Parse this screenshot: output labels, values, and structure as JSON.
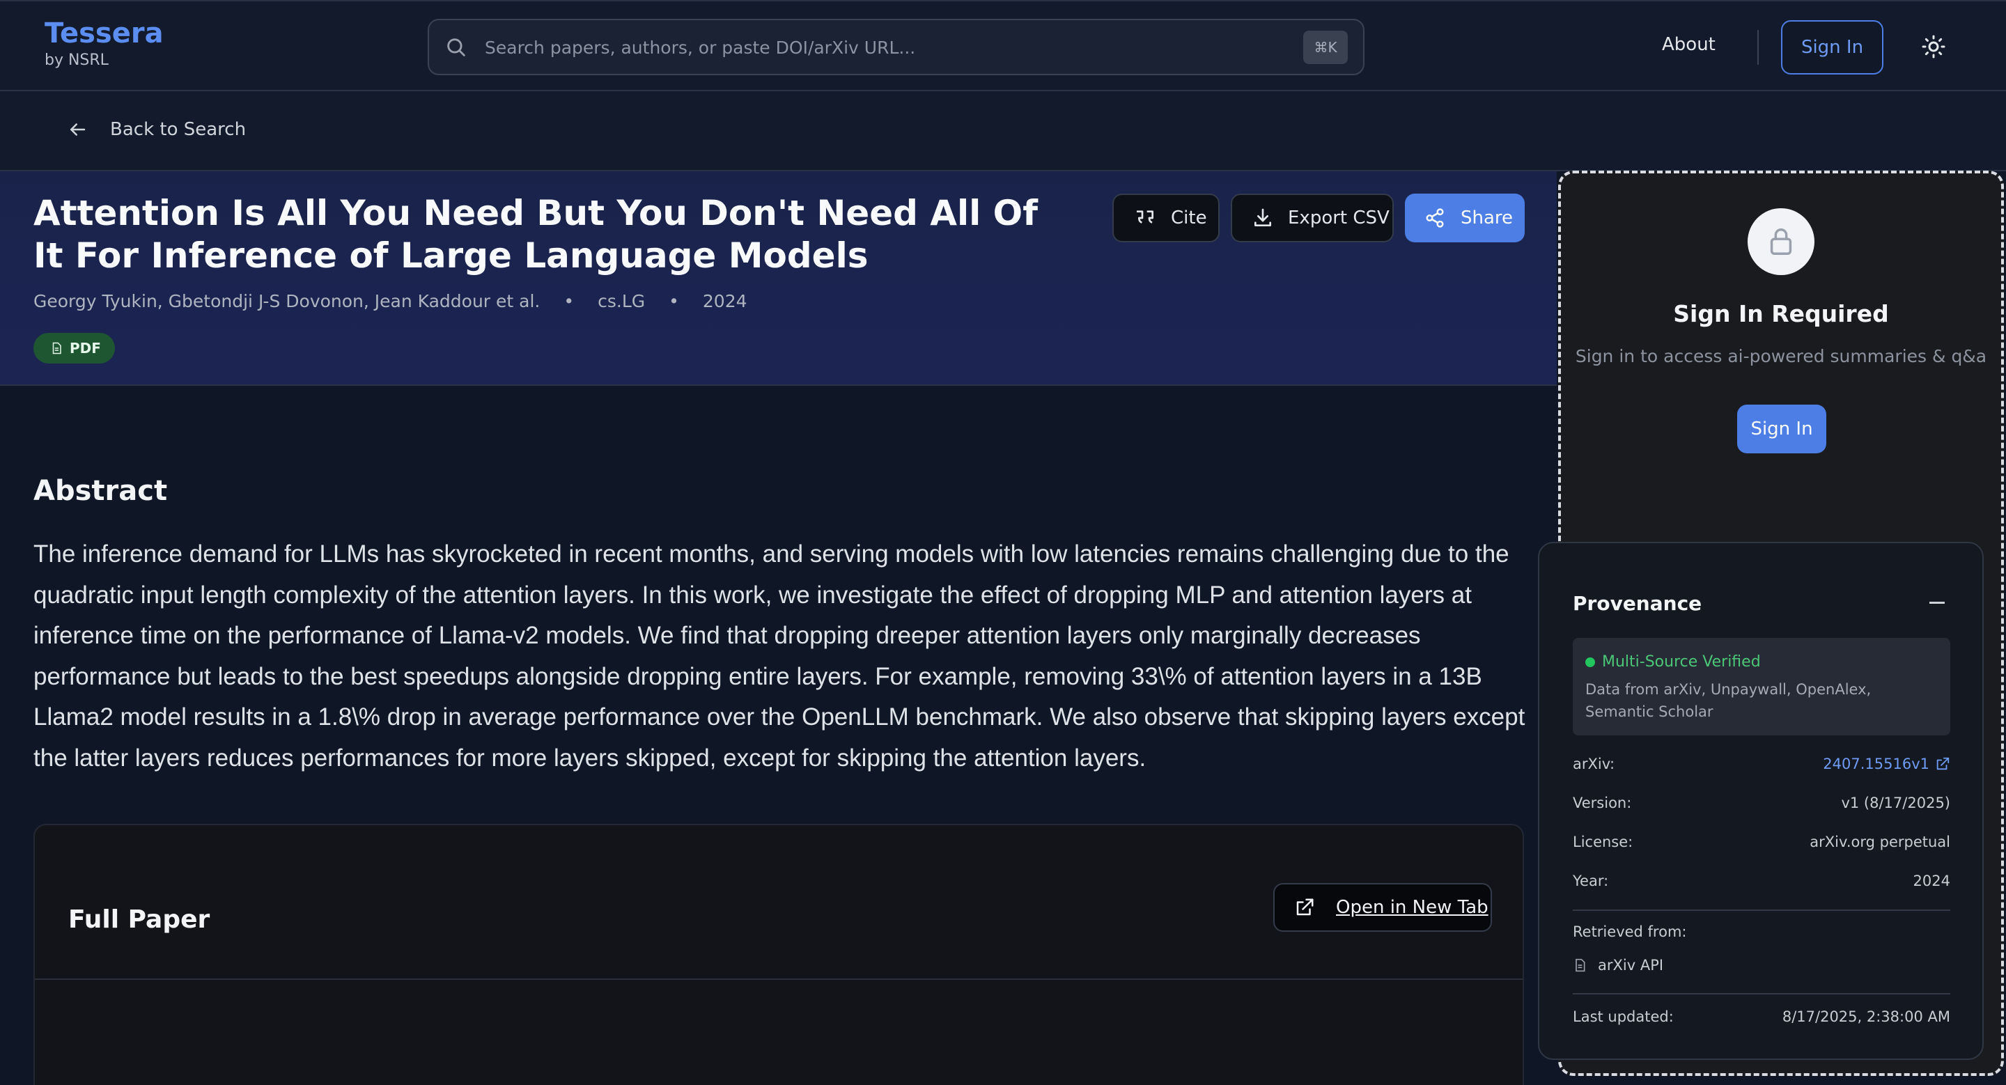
{
  "brand": {
    "name": "Tessera",
    "sub": "by NSRL"
  },
  "search": {
    "placeholder": "Search papers, authors, or paste DOI/arXiv URL...",
    "shortcut": "⌘K"
  },
  "nav": {
    "about": "About",
    "sign_in": "Sign In"
  },
  "back": {
    "label": "Back to Search"
  },
  "paper": {
    "title": "Attention Is All You Need But You Don't Need All Of It For Inference of Large Language Models",
    "authors": "Georgy Tyukin, Gbetondji J-S Dovonon, Jean Kaddour et al.",
    "category": "cs.LG",
    "year": "2024",
    "badge": "PDF"
  },
  "actions": {
    "cite": "Cite",
    "export": "Export CSV",
    "share": "Share"
  },
  "abstract": {
    "heading": "Abstract",
    "text": "The inference demand for LLMs has skyrocketed in recent months, and serving models with low latencies remains challenging due to the quadratic input length complexity of the attention layers. In this work, we investigate the effect of dropping MLP and attention layers at inference time on the performance of Llama-v2 models. We find that dropping dreeper attention layers only marginally decreases performance but leads to the best speedups alongside dropping entire layers. For example, removing 33\\% of attention layers in a 13B Llama2 model results in a 1.8\\% drop in average performance over the OpenLLM benchmark. We also observe that skipping layers except the latter layers reduces performances for more layers skipped, except for skipping the attention layers."
  },
  "full_paper": {
    "title": "Full Paper",
    "open_new_tab": "Open in New Tab"
  },
  "signin_panel": {
    "title": "Sign In Required",
    "subtitle": "Sign in to access ai-powered summaries & q&a",
    "button": "Sign In"
  },
  "provenance": {
    "title": "Provenance",
    "verified": "Multi-Source Verified",
    "sources": "Data from arXiv, Unpaywall, OpenAlex, Semantic Scholar",
    "rows": [
      {
        "key": "arXiv:",
        "value": "2407.15516v1"
      },
      {
        "key": "Version:",
        "value": "v1 (8/17/2025)"
      },
      {
        "key": "License:",
        "value": "arXiv.org perpetual"
      },
      {
        "key": "Year:",
        "value": "2024"
      }
    ],
    "retrieved_label": "Retrieved from:",
    "retrieved_source": "arXiv API",
    "last_updated_label": "Last updated:",
    "last_updated_value": "8/17/2025, 2:38:00 AM"
  },
  "colors": {
    "accent": "#4c7ee6",
    "brand": "#5b8ef0",
    "verified": "#22c55e",
    "badge": "#1e5631"
  }
}
